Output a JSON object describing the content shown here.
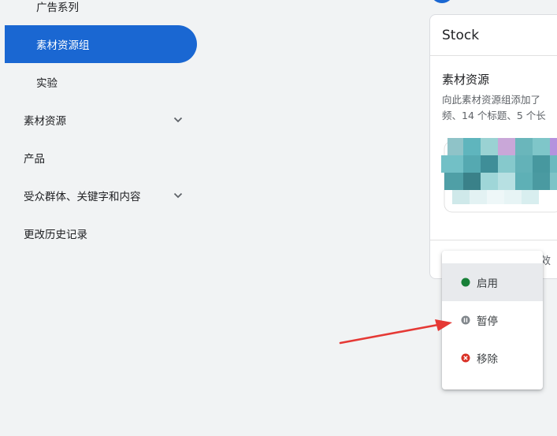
{
  "sidebar": {
    "items": [
      {
        "label": "广告系列"
      },
      {
        "label": "素材资源组"
      },
      {
        "label": "实验"
      },
      {
        "label": "素材资源"
      },
      {
        "label": "产品"
      },
      {
        "label": "受众群体、关键字和内容"
      },
      {
        "label": "更改历史记录"
      }
    ],
    "active_index": 1
  },
  "card": {
    "title": "Stock",
    "subtitle": "素材资源",
    "desc_line1": "向此素材资源组添加了",
    "desc_line2": "频、14 个标题、5 个长",
    "footer_text": "效"
  },
  "status_menu": {
    "items": [
      {
        "label": "启用",
        "icon": "enabled-dot-icon",
        "color": "#188038"
      },
      {
        "label": "暂停",
        "icon": "pause-icon",
        "color": "#80868b"
      },
      {
        "label": "移除",
        "icon": "remove-icon",
        "color": "#d93025"
      }
    ],
    "hovered_index": 0
  },
  "colors": {
    "accent": "#1a67d2",
    "background": "#f1f3f4",
    "annotation_arrow": "#e53935"
  }
}
